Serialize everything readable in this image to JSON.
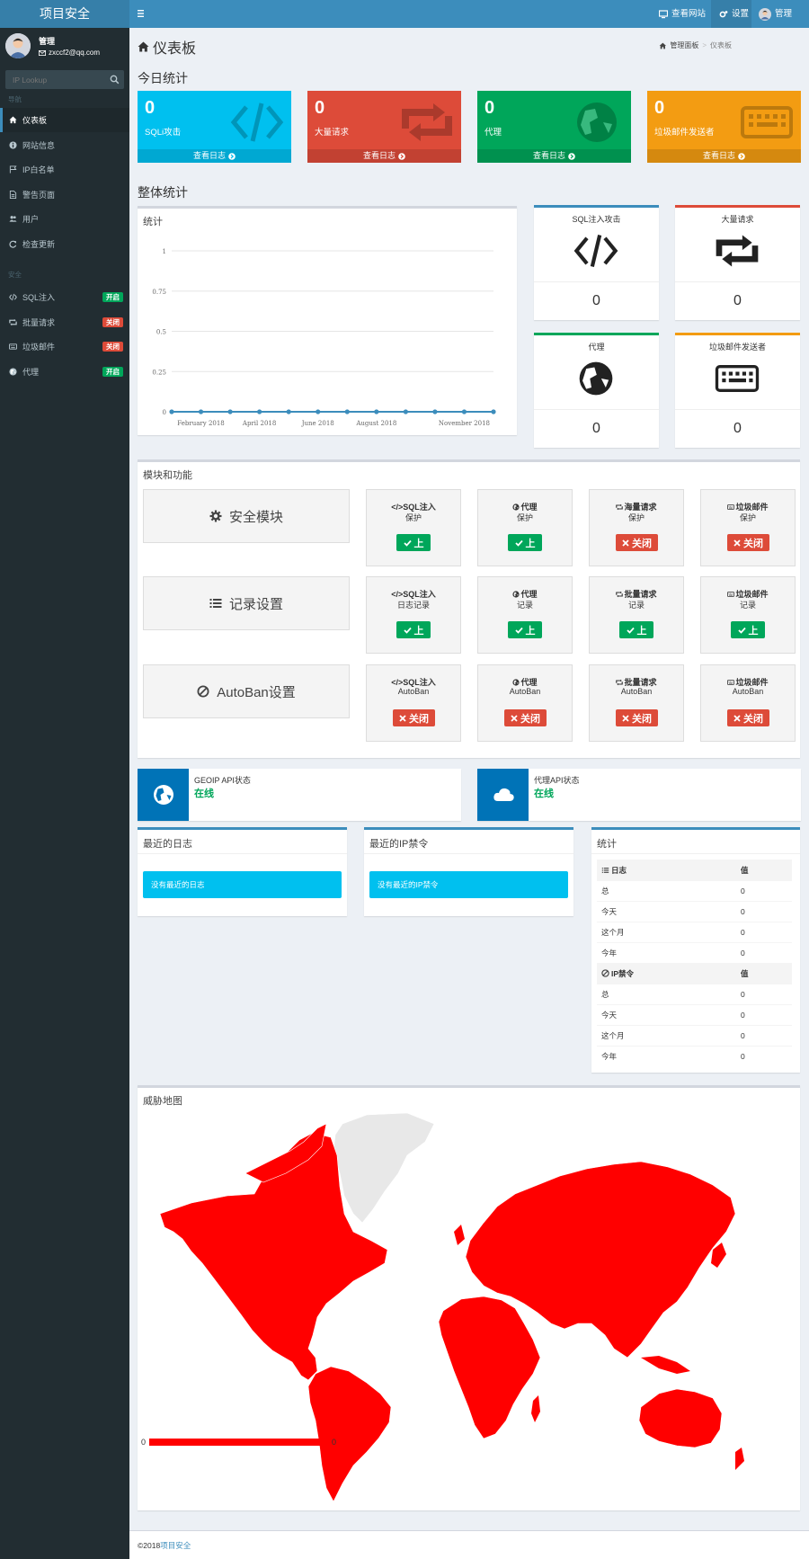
{
  "app": {
    "logo": "项目安全"
  },
  "topbar": {
    "view_site": "查看网站",
    "settings": "设置",
    "user": "管理"
  },
  "user": {
    "name": "管理",
    "email": "zxccf2@qq.com"
  },
  "search": {
    "placeholder": "IP Lookup"
  },
  "sidebar": {
    "nav_header": "导航",
    "nav": [
      {
        "label": "仪表板",
        "icon": "home-icon",
        "active": true
      },
      {
        "label": "网站信息",
        "icon": "info-icon"
      },
      {
        "label": "IP白名单",
        "icon": "flag-icon"
      },
      {
        "label": "警告页面",
        "icon": "file-icon"
      },
      {
        "label": "用户",
        "icon": "users-icon"
      },
      {
        "label": "检查更新",
        "icon": "refresh-icon"
      }
    ],
    "sec_header": "安全",
    "security": [
      {
        "label": "SQL注入",
        "icon": "code-icon",
        "badge": "开启",
        "on": true
      },
      {
        "label": "批量请求",
        "icon": "retweet-icon",
        "badge": "关闭",
        "on": false
      },
      {
        "label": "垃圾邮件",
        "icon": "keyboard-icon",
        "badge": "关闭",
        "on": false
      },
      {
        "label": "代理",
        "icon": "globe-icon",
        "badge": "开启",
        "on": true
      }
    ]
  },
  "page": {
    "title": "仪表板",
    "breadcrumb_home": "管理面板",
    "breadcrumb_current": "仪表板"
  },
  "today": {
    "title": "今日统计",
    "boxes": [
      {
        "value": "0",
        "label": "SQLi攻击",
        "footer": "查看日志",
        "color": "#00c0ef",
        "icon": "code-icon"
      },
      {
        "value": "0",
        "label": "大量请求",
        "footer": "查看日志",
        "color": "#dd4b39",
        "icon": "retweet-icon"
      },
      {
        "value": "0",
        "label": "代理",
        "footer": "查看日志",
        "color": "#00a65a",
        "icon": "globe-icon"
      },
      {
        "value": "0",
        "label": "垃圾邮件发送者",
        "footer": "查看日志",
        "color": "#f39c12",
        "icon": "keyboard-icon"
      }
    ]
  },
  "overall": {
    "title": "整体统计",
    "chart_title": "统计",
    "cards": [
      {
        "label": "SQL注入攻击",
        "value": "0",
        "color": "#3c8dbc",
        "icon": "code-icon"
      },
      {
        "label": "大量请求",
        "value": "0",
        "color": "#dd4b39",
        "icon": "retweet-icon"
      },
      {
        "label": "代理",
        "value": "0",
        "color": "#00a65a",
        "icon": "globe-icon"
      },
      {
        "label": "垃圾邮件发送者",
        "value": "0",
        "color": "#f39c12",
        "icon": "keyboard-icon"
      }
    ]
  },
  "chart_data": {
    "type": "line",
    "title": "",
    "xlabel": "",
    "ylabel": "",
    "ylim": [
      0,
      1
    ],
    "yticks": [
      "0",
      "0.25",
      "0.5",
      "0.75",
      "1"
    ],
    "x_tick_labels": [
      "February 2018",
      "April 2018",
      "June 2018",
      "August 2018",
      "November 2018"
    ],
    "x": [
      "2018-01",
      "2018-02",
      "2018-03",
      "2018-04",
      "2018-05",
      "2018-06",
      "2018-07",
      "2018-08",
      "2018-09",
      "2018-10",
      "2018-11",
      "2018-12"
    ],
    "series": [
      {
        "values": [
          0,
          0,
          0,
          0,
          0,
          0,
          0,
          0,
          0,
          0,
          0,
          0
        ]
      }
    ],
    "grid": true,
    "color": "#3c8dbc"
  },
  "modules": {
    "title": "模块和功能",
    "on_label": "上",
    "off_label": "关闭",
    "rows": [
      {
        "label": "安全模块",
        "icon": "gear-icon",
        "tiles": [
          {
            "l1": "</>SQL注入",
            "l2": "保护",
            "on": true
          },
          {
            "l1": "代理",
            "l2": "保护",
            "on": true,
            "ico": "globe"
          },
          {
            "l1": "海量请求",
            "l2": "保护",
            "on": false,
            "ico": "retweet"
          },
          {
            "l1": "垃圾邮件",
            "l2": "保护",
            "on": false,
            "ico": "keyboard"
          }
        ]
      },
      {
        "label": "记录设置",
        "icon": "list-icon",
        "tiles": [
          {
            "l1": "</>SQL注入",
            "l2": "日志记录",
            "on": true
          },
          {
            "l1": "代理",
            "l2": "记录",
            "on": true,
            "ico": "globe"
          },
          {
            "l1": "批量请求",
            "l2": "记录",
            "on": true,
            "ico": "retweet"
          },
          {
            "l1": "垃圾邮件",
            "l2": "记录",
            "on": true,
            "ico": "keyboard"
          }
        ]
      },
      {
        "label": "AutoBan设置",
        "icon": "ban-icon",
        "tiles": [
          {
            "l1": "</>SQL注入",
            "l2": "AutoBan",
            "on": false
          },
          {
            "l1": "代理",
            "l2": "AutoBan",
            "on": false,
            "ico": "globe"
          },
          {
            "l1": "批量请求",
            "l2": "AutoBan",
            "on": false,
            "ico": "retweet"
          },
          {
            "l1": "垃圾邮件",
            "l2": "AutoBan",
            "on": false,
            "ico": "keyboard"
          }
        ]
      }
    ]
  },
  "api": [
    {
      "label": "GEOIP API状态",
      "status": "在线",
      "icon": "globe-icon"
    },
    {
      "label": "代理API状态",
      "status": "在线",
      "icon": "cloud-icon"
    }
  ],
  "logs": {
    "title": "最近的日志",
    "empty": "没有最近的日志"
  },
  "bans": {
    "title": "最近的IP禁令",
    "empty": "没有最近的IP禁令"
  },
  "stats": {
    "title": "统计",
    "log_header": "日志",
    "value_header": "值",
    "log_rows": [
      [
        "总",
        "0"
      ],
      [
        "今天",
        "0"
      ],
      [
        "这个月",
        "0"
      ],
      [
        "今年",
        "0"
      ]
    ],
    "ban_header": "IP禁令",
    "ban_rows": [
      [
        "总",
        "0"
      ],
      [
        "今天",
        "0"
      ],
      [
        "这个月",
        "0"
      ],
      [
        "今年",
        "0"
      ]
    ]
  },
  "threat_map": {
    "title": "威胁地图",
    "legend_min": "0",
    "legend_max": "0",
    "color": "#ff0000"
  },
  "footer": {
    "copyright": "©2018",
    "link": "项目安全"
  }
}
